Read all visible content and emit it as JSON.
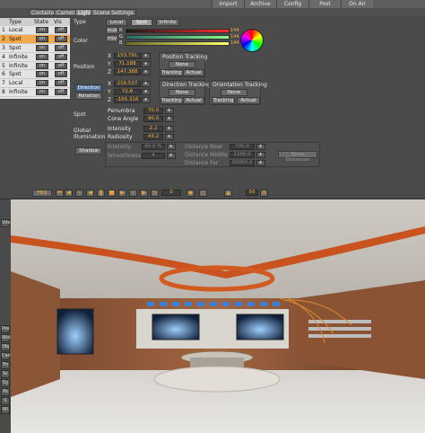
{
  "topbar": {
    "menus": [
      "Import",
      "Archive",
      "Config",
      "Post",
      "On Air"
    ]
  },
  "tabs": [
    "Container",
    "Camera",
    "Light",
    "Scene Settings"
  ],
  "lights_table": {
    "headers": [
      "Type",
      "State",
      "Vis"
    ],
    "rows": [
      {
        "num": "1",
        "type": "Local",
        "state": "on",
        "vis": "off"
      },
      {
        "num": "2",
        "type": "Spot",
        "state": "on",
        "vis": "off"
      },
      {
        "num": "3",
        "type": "Spot",
        "state": "on",
        "vis": "off"
      },
      {
        "num": "4",
        "type": "Infinite",
        "state": "on",
        "vis": "off"
      },
      {
        "num": "5",
        "type": "Infinite",
        "state": "on",
        "vis": "off"
      },
      {
        "num": "6",
        "type": "Spot",
        "state": "on",
        "vis": "off"
      },
      {
        "num": "7",
        "type": "Local",
        "state": "on",
        "vis": "off"
      },
      {
        "num": "8",
        "type": "Infinite",
        "state": "on",
        "vis": "off"
      }
    ]
  },
  "light_type": {
    "label": "Type",
    "options": [
      "Local",
      "Spot",
      "Infinite"
    ]
  },
  "color": {
    "label": "Color",
    "mode": "RGB",
    "hsv": "HSV",
    "channels": [
      {
        "name": "R",
        "value": "144"
      },
      {
        "name": "G",
        "value": "144"
      },
      {
        "name": "B",
        "value": "144"
      }
    ]
  },
  "position": {
    "label": "Position",
    "x": "153.791",
    "y": "71.188",
    "z": "147.388",
    "tracking_title": "Position Tracking",
    "tracking_none": "None",
    "tracking_tracking": "Tracking",
    "tracking_actual": "Actual"
  },
  "direction": {
    "label_dir": "Direction",
    "label_rot": "Rotation",
    "x": "216.537",
    "y": "72.8",
    "z": "-165.316",
    "dir_tracking_title": "Direction Tracking",
    "ori_tracking_title": "Orientation Tracking",
    "none": "None",
    "tracking": "Tracking",
    "actual": "Actual"
  },
  "spot": {
    "label": "Spot",
    "penumbra_label": "Penumbra",
    "penumbra": "70.0",
    "cone_label": "Cone Angle",
    "cone": "90.0"
  },
  "global_illumination": {
    "label": "Global Illumination",
    "intensity_label": "Intensity",
    "intensity": "2.2",
    "radiosity_label": "Radiosity",
    "radiosity": "43.2"
  },
  "shadow": {
    "button": "Shadow",
    "intensity_label": "Intensity",
    "intensity": "60.0 %",
    "smooth_label": "Smoothness",
    "smooth": "4",
    "near_label": "Distance Near",
    "near": "700.0",
    "middle_label": "Distance Middle",
    "middle": "1200.0",
    "far_label": "Distance Far",
    "far": "20000.0",
    "show_label": "Show Distances"
  },
  "viewer": {
    "mode": "FBX",
    "frame_value": "0",
    "frame_end": "50",
    "side_buttons": [
      "Vdx",
      "Pos",
      "Wld",
      "Obj",
      "Cam",
      "Trs",
      "Sc",
      "Oy",
      "Ps",
      "S",
      "Ml"
    ]
  },
  "colors": {
    "accent": "#f5b042",
    "selection": "#f3a94a",
    "panel_bg": "#4b4b4b"
  }
}
